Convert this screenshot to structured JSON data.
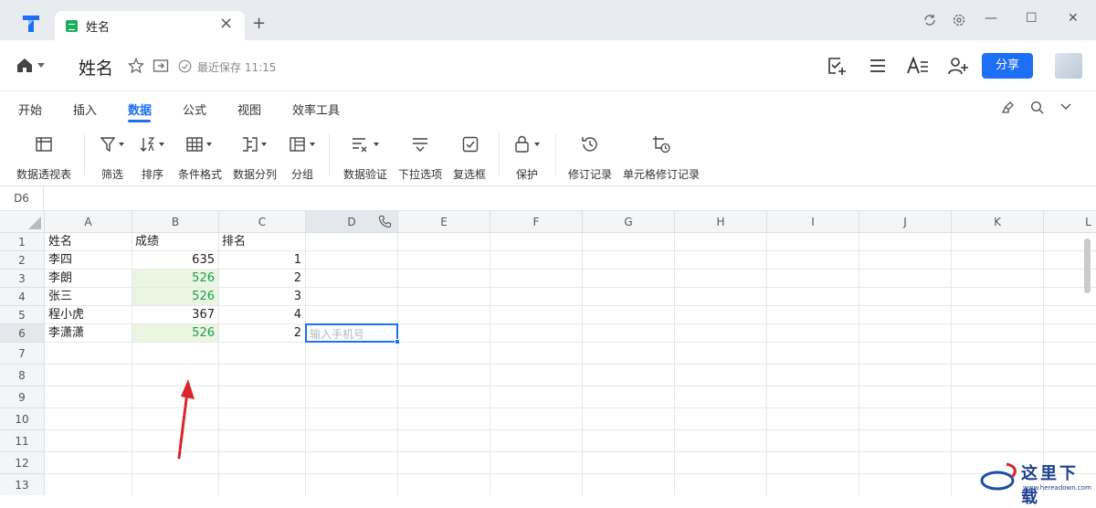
{
  "window": {
    "tab_title": "姓名",
    "tab_close": "×",
    "new_tab": "+",
    "minimize": "—",
    "maximize": "☐",
    "close": "✕"
  },
  "header": {
    "doc_title": "姓名",
    "save_status": "最近保存 11:15",
    "share_label": "分享"
  },
  "ribbon": {
    "tabs": [
      "开始",
      "插入",
      "数据",
      "公式",
      "视图",
      "效率工具"
    ],
    "active_tab": "数据"
  },
  "toolbar": {
    "items": [
      "数据透视表",
      "筛选",
      "排序",
      "条件格式",
      "数据分列",
      "分组",
      "数据验证",
      "下拉选项",
      "复选框",
      "保护",
      "修订记录",
      "单元格修订记录"
    ]
  },
  "formula_bar": {
    "cell_ref": "D6"
  },
  "sheet": {
    "columns": [
      "A",
      "B",
      "C",
      "D",
      "E",
      "F",
      "G",
      "H",
      "I",
      "J",
      "K",
      "L"
    ],
    "rows": [
      "1",
      "2",
      "3",
      "4",
      "5",
      "6",
      "7",
      "8",
      "9",
      "10",
      "11",
      "12",
      "13"
    ],
    "header_row": [
      "姓名",
      "成绩",
      "排名"
    ],
    "data": [
      {
        "name": "李四",
        "score": "635",
        "rank": "1",
        "duplicate": false
      },
      {
        "name": "李朗",
        "score": "526",
        "rank": "2",
        "duplicate": true
      },
      {
        "name": "张三",
        "score": "526",
        "rank": "3",
        "duplicate": true
      },
      {
        "name": "程小虎",
        "score": "367",
        "rank": "4",
        "duplicate": false
      },
      {
        "name": "李潇潇",
        "score": "526",
        "rank": "2",
        "duplicate": true
      }
    ],
    "active_cell_placeholder": "输入手机号",
    "selected_column": "D",
    "selected_row": "6"
  },
  "colors": {
    "accent": "#1c6ff6",
    "duplicate_fill": "#eaf6e2",
    "duplicate_text": "#1f9d4c",
    "arrow": "#d9262c"
  },
  "watermark": {
    "text": "这里下载",
    "url_text": "www.hereadown.com"
  }
}
